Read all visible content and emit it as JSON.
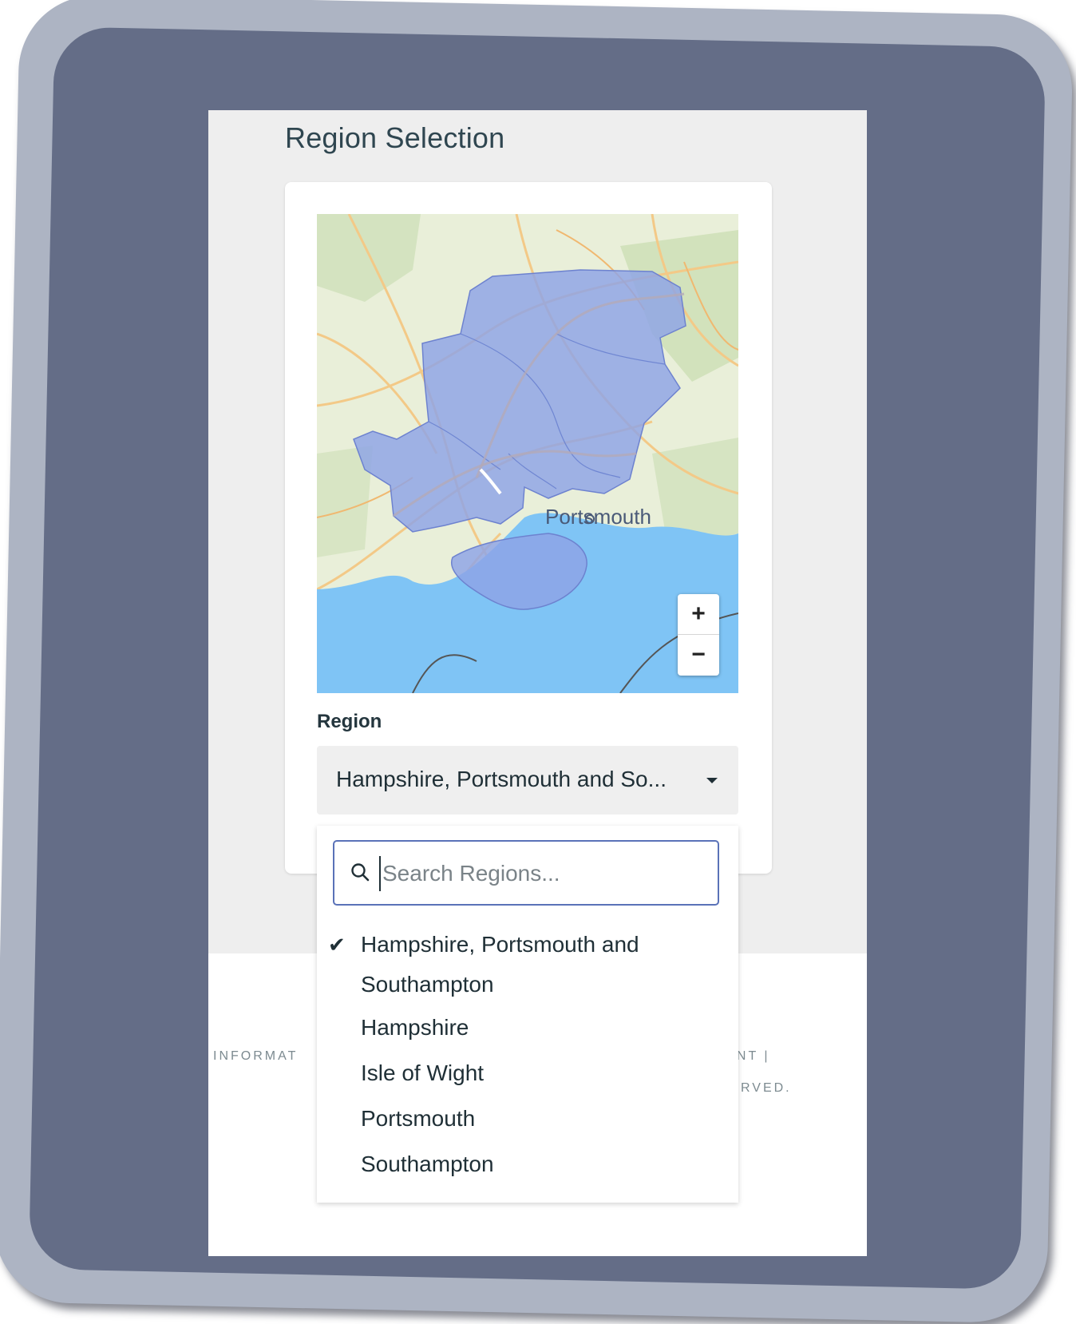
{
  "page": {
    "title": "Region Selection"
  },
  "map": {
    "place_label": "Portsmouth",
    "zoom_in_label": "+",
    "zoom_out_label": "−",
    "colors": {
      "land": "#e9efd9",
      "sea": "#7fc4f5",
      "region_fill": "#8ea4e6",
      "roads": "#f3c987"
    }
  },
  "region_field": {
    "label": "Region",
    "selected_value": "Hampshire, Portsmouth and So..."
  },
  "dropdown": {
    "search_placeholder": "Search Regions...",
    "options": [
      {
        "label": "Hampshire, Portsmouth and Southampton",
        "selected": true
      },
      {
        "label": "Hampshire",
        "selected": false
      },
      {
        "label": "Isle of Wight",
        "selected": false
      },
      {
        "label": "Portsmouth",
        "selected": false
      },
      {
        "label": "Southampton",
        "selected": false
      }
    ]
  },
  "footer": {
    "left_fragment": "INFORMAT",
    "right_fragment_1": "NSENT |",
    "right_fragment_2": "ESERVED."
  }
}
